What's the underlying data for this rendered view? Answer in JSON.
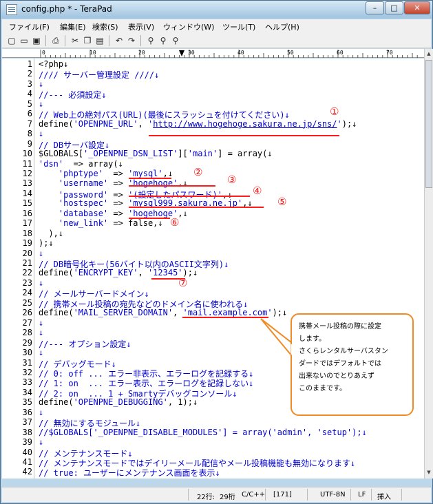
{
  "window": {
    "title": "config.php * - TeraPad",
    "min_glyph": "–",
    "max_glyph": "□",
    "close_glyph": "✕"
  },
  "menu": [
    "ファイル(F)",
    "編集(E)",
    "検索(S)",
    "表示(V)",
    "ウィンドウ(W)",
    "ツール(T)",
    "ヘルプ(H)"
  ],
  "toolbar": [
    "new-file-icon",
    "open-file-icon",
    "save-icon",
    "print-icon",
    "cut-icon",
    "copy-icon",
    "paste-icon",
    "undo-icon",
    "redo-icon",
    "find-icon",
    "find-prev-icon",
    "find-next-icon"
  ],
  "ruler": [
    "0",
    "10",
    "20",
    "30",
    "40",
    "50",
    "60",
    "70"
  ],
  "lines": [
    {
      "no": "1",
      "parts": [
        {
          "t": "<?php↓",
          "c": "k"
        }
      ]
    },
    {
      "no": "2",
      "parts": [
        {
          "t": "//// サーバー管理設定 ////↓",
          "c": "c"
        }
      ]
    },
    {
      "no": "3",
      "parts": [
        {
          "t": "↓",
          "c": "c"
        }
      ]
    },
    {
      "no": "4",
      "parts": [
        {
          "t": "//--- 必須設定↓",
          "c": "c"
        }
      ]
    },
    {
      "no": "5",
      "parts": [
        {
          "t": "↓",
          "c": "c"
        }
      ]
    },
    {
      "no": "6",
      "parts": [
        {
          "t": "// Web上の絶対パス(URL)(最後にスラッシュを付けてください)↓",
          "c": "c"
        }
      ]
    },
    {
      "no": "7",
      "parts": [
        {
          "t": "define(",
          "c": "k"
        },
        {
          "t": "'OPENPNE_URL'",
          "c": "s"
        },
        {
          "t": ", ",
          "c": "k"
        },
        {
          "t": "'",
          "c": "s"
        },
        {
          "t": "http://www.hogehoge.sakura.ne.jp/sns/",
          "c": "u"
        },
        {
          "t": "'",
          "c": "s"
        },
        {
          "t": ");↓",
          "c": "k"
        }
      ]
    },
    {
      "no": "8",
      "parts": [
        {
          "t": "↓",
          "c": "c"
        }
      ]
    },
    {
      "no": "9",
      "parts": [
        {
          "t": "// DBサーバ設定↓",
          "c": "c"
        }
      ]
    },
    {
      "no": "10",
      "parts": [
        {
          "t": "$GLOBALS[",
          "c": "k"
        },
        {
          "t": "'_OPENPNE_DSN_LIST'",
          "c": "s"
        },
        {
          "t": "][",
          "c": "k"
        },
        {
          "t": "'main'",
          "c": "s"
        },
        {
          "t": "] = array(↓",
          "c": "k"
        }
      ]
    },
    {
      "no": "11",
      "parts": [
        {
          "t": "'dsn'",
          "c": "s"
        },
        {
          "t": "  => array(↓",
          "c": "k"
        }
      ]
    },
    {
      "no": "12",
      "parts": [
        {
          "t": "    ",
          "c": "k"
        },
        {
          "t": "'phptype'",
          "c": "s"
        },
        {
          "t": "  => ",
          "c": "k"
        },
        {
          "t": "'mysql'",
          "c": "s"
        },
        {
          "t": ",↓",
          "c": "k"
        }
      ]
    },
    {
      "no": "13",
      "parts": [
        {
          "t": "    ",
          "c": "k"
        },
        {
          "t": "'username'",
          "c": "s"
        },
        {
          "t": " => ",
          "c": "k"
        },
        {
          "t": "'hogehoge'",
          "c": "s"
        },
        {
          "t": ",↓",
          "c": "k"
        }
      ]
    },
    {
      "no": "14",
      "parts": [
        {
          "t": "    ",
          "c": "k"
        },
        {
          "t": "'password'",
          "c": "s"
        },
        {
          "t": " => ",
          "c": "k"
        },
        {
          "t": "'(設定したパスワード)'",
          "c": "s"
        },
        {
          "t": ",↓",
          "c": "k"
        }
      ]
    },
    {
      "no": "15",
      "parts": [
        {
          "t": "    ",
          "c": "k"
        },
        {
          "t": "'hostspec'",
          "c": "s"
        },
        {
          "t": " => ",
          "c": "k"
        },
        {
          "t": "'mysql999.sakura.ne.jp'",
          "c": "s"
        },
        {
          "t": ",↓",
          "c": "k"
        }
      ]
    },
    {
      "no": "16",
      "parts": [
        {
          "t": "    ",
          "c": "k"
        },
        {
          "t": "'database'",
          "c": "s"
        },
        {
          "t": " => ",
          "c": "k"
        },
        {
          "t": "'hogehoge'",
          "c": "s"
        },
        {
          "t": ",↓",
          "c": "k"
        }
      ]
    },
    {
      "no": "17",
      "parts": [
        {
          "t": "    ",
          "c": "k"
        },
        {
          "t": "'new_link'",
          "c": "s"
        },
        {
          "t": " => false,↓",
          "c": "k"
        }
      ]
    },
    {
      "no": "18",
      "parts": [
        {
          "t": "  ),↓",
          "c": "k"
        }
      ]
    },
    {
      "no": "19",
      "parts": [
        {
          "t": ");↓",
          "c": "k"
        }
      ]
    },
    {
      "no": "20",
      "parts": [
        {
          "t": "↓",
          "c": "c"
        }
      ]
    },
    {
      "no": "21",
      "parts": [
        {
          "t": "// DB暗号化キー(56バイト以内のASCII文字列)↓",
          "c": "c"
        }
      ]
    },
    {
      "no": "22",
      "parts": [
        {
          "t": "define(",
          "c": "k"
        },
        {
          "t": "'ENCRYPT_KEY'",
          "c": "s"
        },
        {
          "t": ", ",
          "c": "k"
        },
        {
          "t": "'12345'",
          "c": "s"
        },
        {
          "t": ");↓",
          "c": "k"
        }
      ]
    },
    {
      "no": "23",
      "parts": [
        {
          "t": "↓",
          "c": "c"
        }
      ]
    },
    {
      "no": "24",
      "parts": [
        {
          "t": "// メールサーバードメイン↓",
          "c": "c"
        }
      ]
    },
    {
      "no": "25",
      "parts": [
        {
          "t": "// 携帯メール投稿の宛先などのドメイン名に使われる↓",
          "c": "c"
        }
      ]
    },
    {
      "no": "26",
      "parts": [
        {
          "t": "define(",
          "c": "k"
        },
        {
          "t": "'MAIL_SERVER_DOMAIN'",
          "c": "s"
        },
        {
          "t": ", ",
          "c": "k"
        },
        {
          "t": "'mail.example.com'",
          "c": "s"
        },
        {
          "t": ");↓",
          "c": "k"
        }
      ]
    },
    {
      "no": "27",
      "parts": [
        {
          "t": "↓",
          "c": "c"
        }
      ]
    },
    {
      "no": "28",
      "parts": [
        {
          "t": "↓",
          "c": "c"
        }
      ]
    },
    {
      "no": "29",
      "parts": [
        {
          "t": "//--- オプション設定↓",
          "c": "c"
        }
      ]
    },
    {
      "no": "30",
      "parts": [
        {
          "t": "↓",
          "c": "c"
        }
      ]
    },
    {
      "no": "31",
      "parts": [
        {
          "t": "// デバッグモード↓",
          "c": "c"
        }
      ]
    },
    {
      "no": "32",
      "parts": [
        {
          "t": "// 0: off ... エラー非表示、エラーログを記録する↓",
          "c": "c"
        }
      ]
    },
    {
      "no": "33",
      "parts": [
        {
          "t": "// 1: on  ... エラー表示、エラーログを記録しない↓",
          "c": "c"
        }
      ]
    },
    {
      "no": "34",
      "parts": [
        {
          "t": "// 2: on  ... 1 + Smartyデバッグコンソール↓",
          "c": "c"
        }
      ]
    },
    {
      "no": "35",
      "parts": [
        {
          "t": "define(",
          "c": "k"
        },
        {
          "t": "'OPENPNE_DEBUGGING'",
          "c": "s"
        },
        {
          "t": ", 1);↓",
          "c": "k"
        }
      ]
    },
    {
      "no": "36",
      "parts": [
        {
          "t": "↓",
          "c": "c"
        }
      ]
    },
    {
      "no": "37",
      "parts": [
        {
          "t": "// 無効にするモジュール↓",
          "c": "c"
        }
      ]
    },
    {
      "no": "38",
      "parts": [
        {
          "t": "//$GLOBALS['_OPENPNE_DISABLE_MODULES'] = array('admin', 'setup');↓",
          "c": "c"
        }
      ]
    },
    {
      "no": "39",
      "parts": [
        {
          "t": "↓",
          "c": "c"
        }
      ]
    },
    {
      "no": "40",
      "parts": [
        {
          "t": "// メンテナンスモード↓",
          "c": "c"
        }
      ]
    },
    {
      "no": "41",
      "parts": [
        {
          "t": "// メンテナンスモードではデイリーメール配信やメール投稿機能も無効になります↓",
          "c": "c"
        }
      ]
    },
    {
      "no": "42",
      "parts": [
        {
          "t": "// true: ユーザーにメンテナンス画面を表示↓",
          "c": "c"
        }
      ]
    }
  ],
  "annotations": [
    "①",
    "②",
    "③",
    "④",
    "⑤",
    "⑥",
    "⑦"
  ],
  "callout": {
    "lines": [
      "携帯メール投稿の際に設定",
      "します。",
      "さくらレンタルサーバスタン",
      "ダードではデフォルトでは",
      "出来ないのでとりあえず",
      "このままです。"
    ],
    "border_color": "#f08a24"
  },
  "status": {
    "row": "22行:",
    "col": "29桁",
    "mode": "C/C++",
    "code": "[171]",
    "encoding": "UTF-8N",
    "newline": "LF",
    "insert": "挿入"
  },
  "colors": {
    "code_blue": "#0000d4",
    "annotation_red": "#ff1a1a"
  }
}
